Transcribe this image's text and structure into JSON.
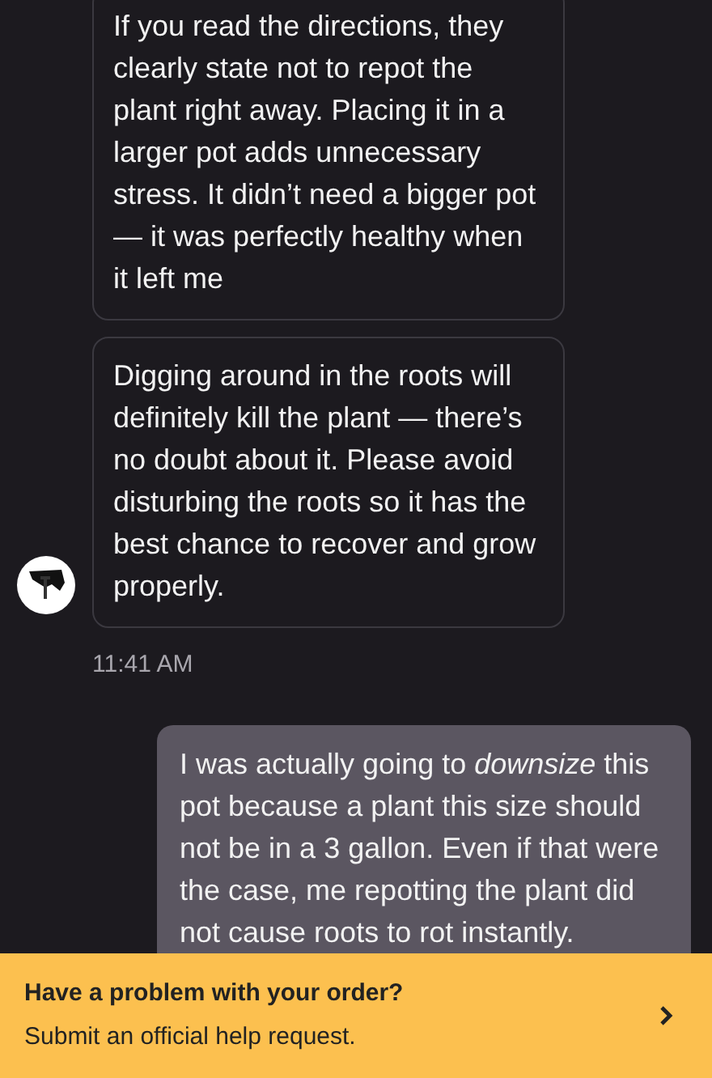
{
  "messages": [
    {
      "kind": "incoming",
      "text": "If you read the directions, they clearly state not to repot the plant right away. Placing it in a larger pot adds unnecessary stress. It didn’t need a bigger pot — it was perfectly healthy when it left me"
    },
    {
      "kind": "incoming",
      "text": "Digging around in the roots will definitely kill the plant — there’s no doubt about it. Please avoid disturbing the roots so it has the best chance to recover and grow properly.",
      "avatar": true
    },
    {
      "kind": "time",
      "text": "11:41 AM"
    },
    {
      "kind": "outgoing",
      "text": "I was actually going to *downsize* this pot because a plant this size should not be in a 3 gallon. Even if that were the case, me repotting the plant did not cause roots to rot instantly."
    }
  ],
  "banner": {
    "title": "Have a problem with your order?",
    "subtitle": "Submit an official help request."
  }
}
